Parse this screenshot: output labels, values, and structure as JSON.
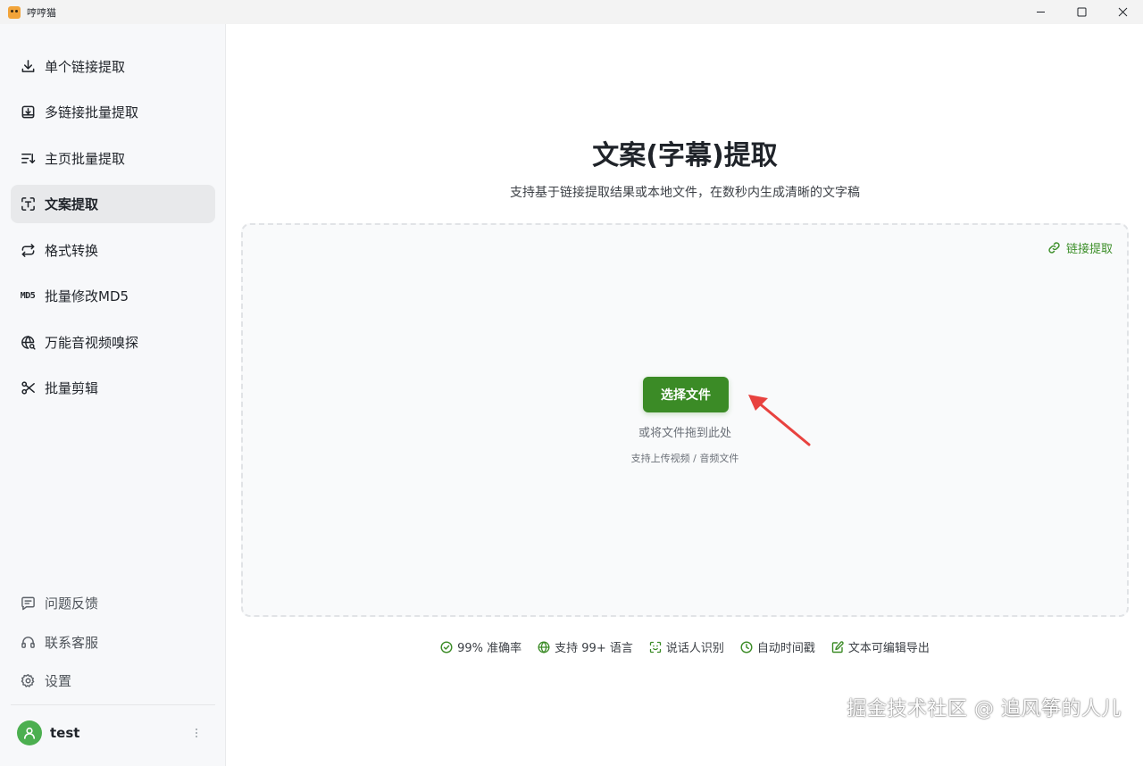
{
  "app": {
    "title": "哼哼猫"
  },
  "sidebar": {
    "items": [
      {
        "label": "单个链接提取",
        "icon": "download-icon"
      },
      {
        "label": "多链接批量提取",
        "icon": "inbox-download-icon"
      },
      {
        "label": "主页批量提取",
        "icon": "list-sort-icon"
      },
      {
        "label": "文案提取",
        "icon": "text-scan-icon",
        "active": true
      },
      {
        "label": "格式转换",
        "icon": "repeat-icon"
      },
      {
        "label": "批量修改MD5",
        "icon": "md5-icon",
        "icon_text": "MD5"
      },
      {
        "label": "万能音视频嗅探",
        "icon": "globe-search-icon"
      },
      {
        "label": "批量剪辑",
        "icon": "scissors-icon"
      }
    ],
    "bottom": [
      {
        "label": "问题反馈",
        "icon": "message-icon"
      },
      {
        "label": "联系客服",
        "icon": "headset-icon"
      },
      {
        "label": "设置",
        "icon": "gear-icon"
      }
    ],
    "user": {
      "name": "test"
    }
  },
  "main": {
    "title": "文案(字幕)提取",
    "subtitle": "支持基于链接提取结果或本地文件，在数秒内生成清晰的文字稿",
    "link_extract_label": "链接提取",
    "select_button": "选择文件",
    "drop_hint": "或将文件拖到此处",
    "format_hint": "支持上传视频 / 音频文件",
    "features": [
      {
        "label": "99% 准确率",
        "icon": "check-circle-icon"
      },
      {
        "label": "支持 99+ 语言",
        "icon": "globe-icon"
      },
      {
        "label": "说话人识别",
        "icon": "face-scan-icon"
      },
      {
        "label": "自动时间戳",
        "icon": "clock-icon"
      },
      {
        "label": "文本可编辑导出",
        "icon": "edit-icon"
      }
    ]
  },
  "watermark": "掘金技术社区 @ 追风筝的人儿",
  "colors": {
    "accent": "#3b8b26",
    "active_bg": "#e8e9eb",
    "sidebar_bg": "#f7f8fa",
    "annotation_arrow": "#e8423f"
  }
}
